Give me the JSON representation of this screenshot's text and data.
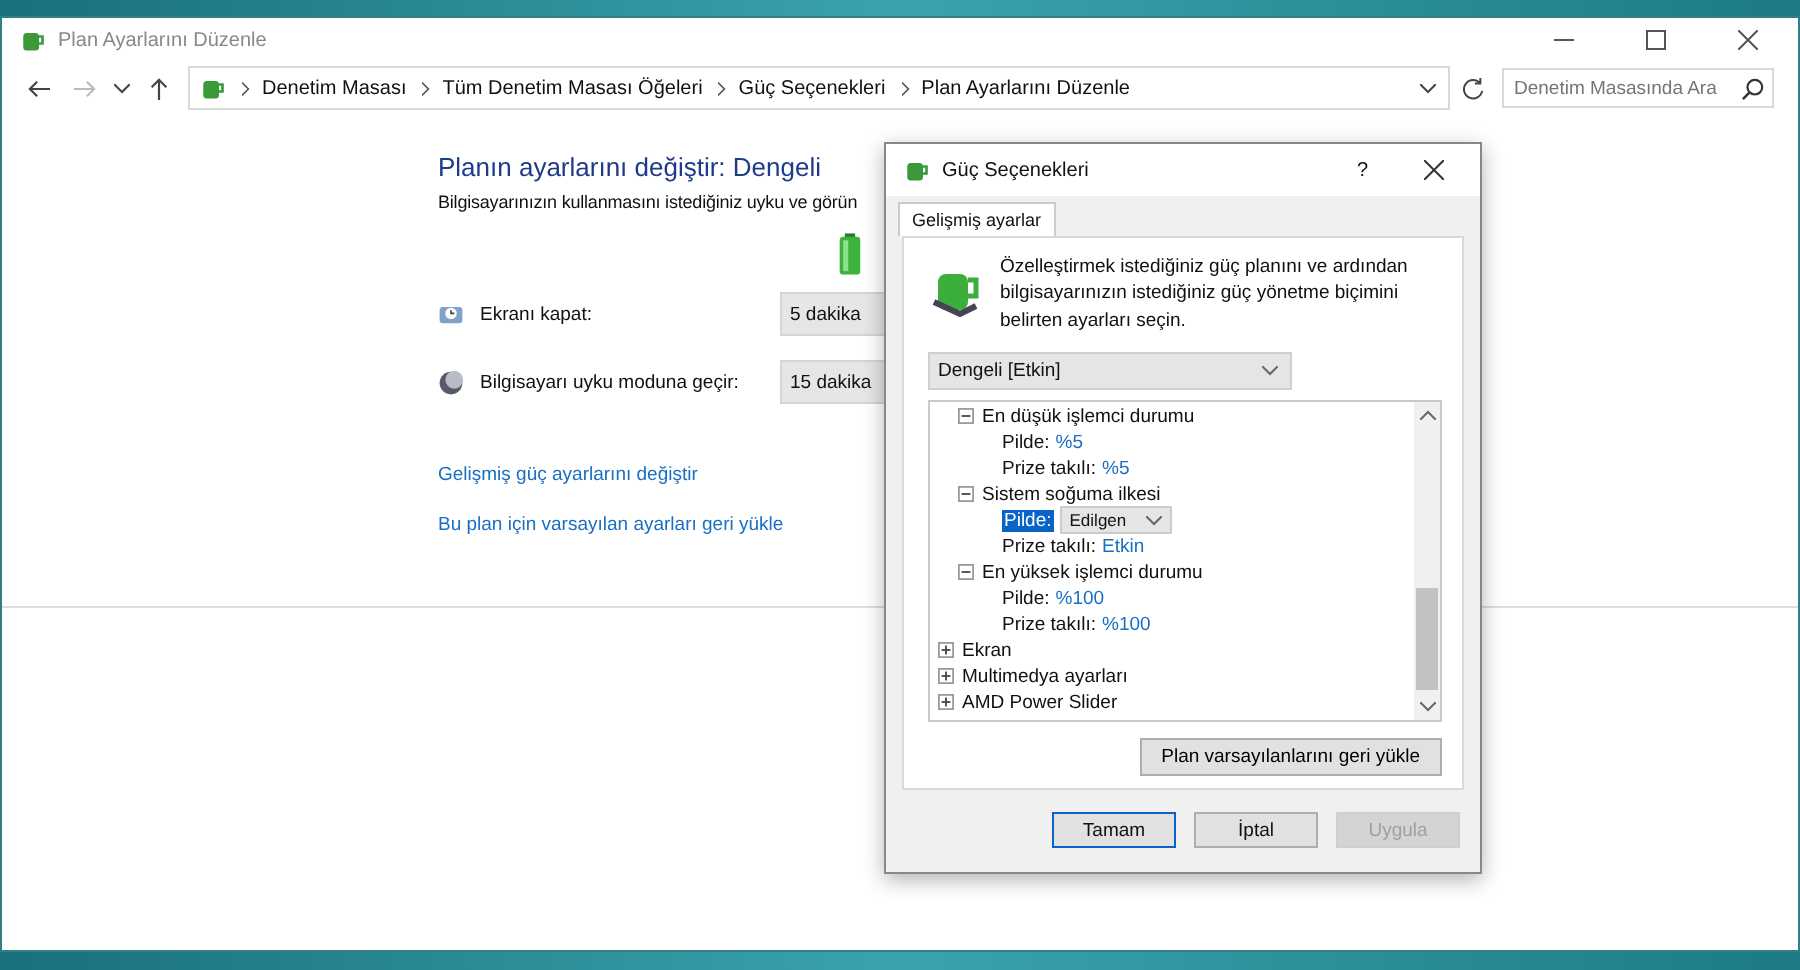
{
  "window": {
    "title": "Plan Ayarlarını Düzenle"
  },
  "address_bar": {
    "breadcrumbs": [
      "Denetim Masası",
      "Tüm Denetim Masası Öğeleri",
      "Güç Seçenekleri",
      "Plan Ayarlarını Düzenle"
    ],
    "search": {
      "placeholder": "Denetim Masasında Ara"
    }
  },
  "main": {
    "heading": "Planın ayarlarını değiştir: Dengeli",
    "description": "Bilgisayarınızın kullanmasını istediğiniz uyku ve görün",
    "settings": [
      {
        "kind": "display",
        "label": "Ekranı kapat:",
        "value": "5 dakika"
      },
      {
        "kind": "sleep",
        "label": "Bilgisayarı uyku moduna geçir:",
        "value": "15 dakika"
      }
    ],
    "links": [
      "Gelişmiş güç ayarlarını değiştir",
      "Bu plan için varsayılan ayarları geri yükle"
    ]
  },
  "dialog": {
    "title": "Güç Seçenekleri",
    "help": "?",
    "tabs": [
      {
        "label": "Gelişmiş ayarlar",
        "selected": true
      }
    ],
    "intro": "Özelleştirmek istediğiniz güç planını ve ardından bilgisayarınızın istediğiniz güç yönetme biçimini belirten ayarları seçin.",
    "plan": "Dengeli [Etkin]",
    "tree": [
      {
        "label": "En düşük işlemci durumu",
        "expanded": true,
        "children": [
          {
            "label": "Pilde:",
            "value": "%5",
            "selected": false,
            "kind": "value"
          },
          {
            "label": "Prize takılı:",
            "value": "%5",
            "selected": false,
            "kind": "value"
          }
        ]
      },
      {
        "label": "Sistem soğuma ilkesi",
        "expanded": true,
        "children": [
          {
            "label": "Pilde:",
            "value": "Edilgen",
            "selected": true,
            "kind": "dropdown"
          },
          {
            "label": "Prize takılı:",
            "value": "Etkin",
            "selected": false,
            "kind": "value"
          }
        ]
      },
      {
        "label": "En yüksek işlemci durumu",
        "expanded": true,
        "children": [
          {
            "label": "Pilde:",
            "value": "%100",
            "selected": false,
            "kind": "value"
          },
          {
            "label": "Prize takılı:",
            "value": "%100",
            "selected": false,
            "kind": "value"
          }
        ]
      },
      {
        "label": "Ekran",
        "expanded": false
      },
      {
        "label": "Multimedya ayarları",
        "expanded": false
      },
      {
        "label": "AMD Power Slider",
        "expanded": false
      }
    ],
    "restore_button": "Plan varsayılanlarını geri yükle",
    "buttons": [
      {
        "label": "Tamam",
        "disabled": false,
        "default": true
      },
      {
        "label": "İptal",
        "disabled": false,
        "default": false
      },
      {
        "label": "Uygula",
        "disabled": true,
        "default": false
      }
    ]
  }
}
